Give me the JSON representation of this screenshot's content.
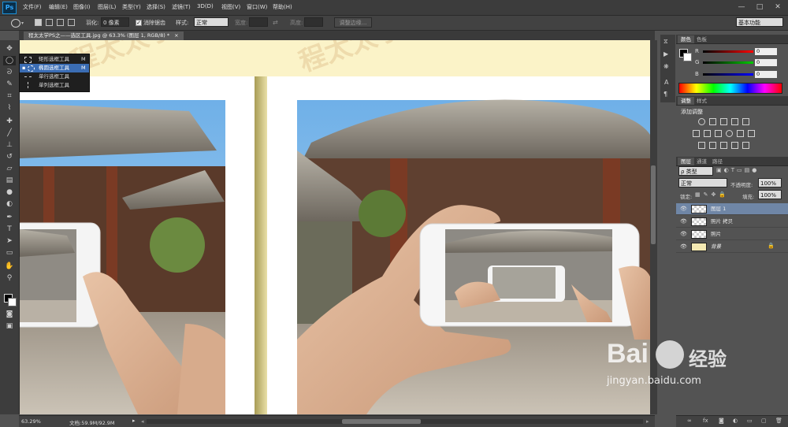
{
  "app": {
    "logo": "Ps",
    "menus": [
      "文件(F)",
      "编辑(E)",
      "图像(I)",
      "图层(L)",
      "类型(Y)",
      "选择(S)",
      "滤镜(T)",
      "3D(D)",
      "视图(V)",
      "窗口(W)",
      "帮助(H)"
    ],
    "window_controls": [
      "—",
      "□",
      "✕"
    ]
  },
  "options_bar": {
    "feather_label": "羽化:",
    "feather_value": "0 像素",
    "antialias_label": "消除锯齿",
    "style_label": "样式:",
    "style_value": "正常",
    "width_label": "宽度:",
    "height_label": "高度:",
    "refine_edge": "调整边缘...",
    "workspace": "基本功能"
  },
  "document": {
    "tab_label": "程太太学PS之——选区工具.jpg @ 63.3% (图层 1, RGB/8) *",
    "tab_close": "×",
    "watermark_text": "程太太学PS之——选区工具"
  },
  "tool_flyout": {
    "items": [
      {
        "label": "矩形选框工具",
        "key": "M"
      },
      {
        "label": "椭圆选框工具",
        "key": "M"
      },
      {
        "label": "单行选框工具",
        "key": ""
      },
      {
        "label": "单列选框工具",
        "key": ""
      }
    ],
    "selected_index": 1
  },
  "status": {
    "zoom": "63.29%",
    "doc_info": "文档:59.9M/92.9M"
  },
  "color_panel": {
    "tabs": [
      "颜色",
      "色板"
    ],
    "channels": [
      {
        "label": "R",
        "value": "0"
      },
      {
        "label": "G",
        "value": "0"
      },
      {
        "label": "B",
        "value": "0"
      }
    ],
    "colors": {
      "r": "#e02020",
      "g": "#20a020",
      "b": "#2040e0"
    }
  },
  "adjustments_panel": {
    "tabs": [
      "调整",
      "样式"
    ],
    "title": "添加调整"
  },
  "layers_panel": {
    "tabs": [
      "图层",
      "通道",
      "路径"
    ],
    "filter_kind": "ρ 类型",
    "blend_mode": "正常",
    "opacity_label": "不透明度:",
    "opacity_value": "100%",
    "lock_label": "锁定:",
    "fill_label": "填充:",
    "fill_value": "100%",
    "layers": [
      {
        "name": "图层 1",
        "selected": true,
        "locked": false
      },
      {
        "name": "照片 拷贝",
        "selected": false,
        "locked": false
      },
      {
        "name": "照片",
        "selected": false,
        "locked": false
      },
      {
        "name": "背景",
        "selected": false,
        "locked": true
      }
    ],
    "footer_icons": [
      "link-icon",
      "fx-icon",
      "mask-icon",
      "adjustment-icon",
      "folder-icon",
      "new-layer-icon",
      "trash-icon"
    ]
  },
  "baidu_watermark": {
    "brand": "Bai",
    "brand_suffix": "经验",
    "url": "jingyan.baidu.com"
  }
}
